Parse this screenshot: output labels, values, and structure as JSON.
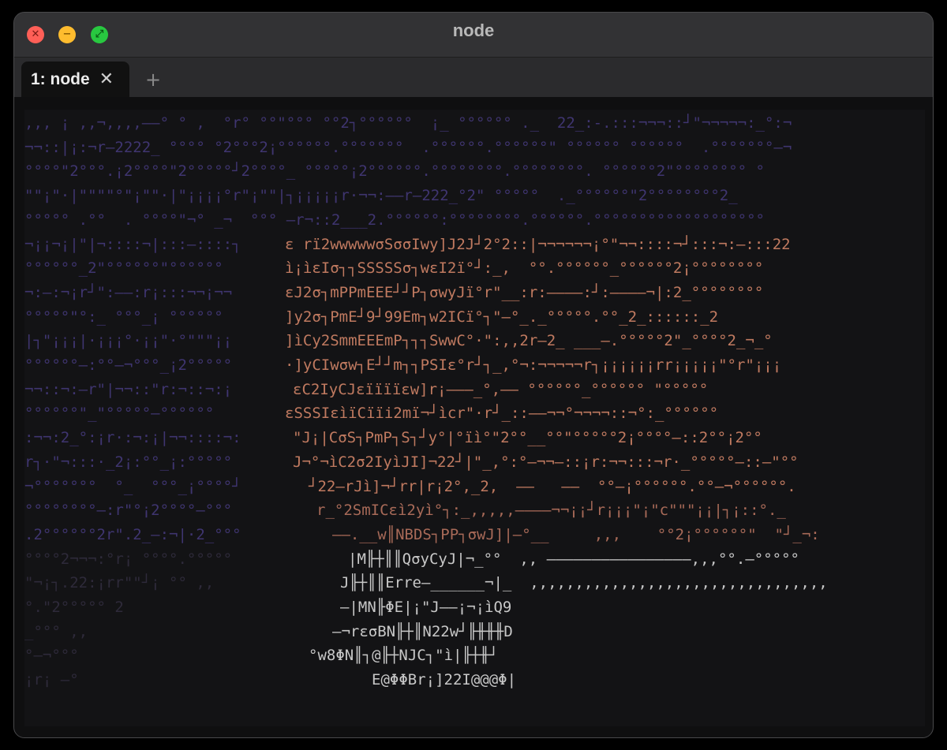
{
  "window": {
    "title": "node",
    "traffic": {
      "close": "✕",
      "minimize": "−",
      "maximize": "⤢"
    }
  },
  "tabs": [
    {
      "label": "1: node",
      "close_icon": "✕"
    }
  ],
  "add_tab_icon": "+",
  "terminal": {
    "background_lines": [
      ",,, ¡ ,,¬,,,,——° ° ,  °r° °°\"°°° °°2┐°°°°°°  ¡_ °°°°°° ._  22_:-.:::¬¬¬::┘\"¬¬¬¬¬:_°:¬",
      "¬¬::|¡:¬r—2222_ °°°° °2°°°2¡°°°°°°.°°°°°°°  .°°°°°°.°°°°°°\" °°°°°° °°°°°°  .°°°°°°°—¬",
      "°°°°\"2°°°.¡2°°°°\"2°°°°°┘2°°°°_ °°°°°¡2°°°°°°.°°°°°°°°.°°°°°°°°. °°°°°°2\"°°°°°°°° °",
      "\"\"¡\"·|\"\"\"\"°\"¡\"\"·|\"¡¡¡¡°r\"¡\"\"|┐¡¡¡¡¡r·¬¬:——r—222_°2\" °°°°°  ._°°°°°°\"2°°°°°°°°2_",
      "°°°°° .°°  . °°°°\"¬° _¬  °°° —r¬::2___2.°°°°°°:°°°°°°°°.°°°°°°.°°°°°°°°°°°°°°°°°°°",
      "¬¡¡¬¡|\"|¬::::¬|:::—::::┐",
      "°°°°°°_2\"°°°°°°\"°°°°°°",
      "¬:—:¬¡r┘\":——:r¡:::¬¬¡¬¬",
      "°°°°°\"°:_ °°°_¡ °°°°°°",
      "|┐\"¡¡¡|·¡¡¡°·¡¡\"·°\"\"\"¡¡",
      "°°°°°°—:°°—¬°°°_¡2°°°°°",
      "¬¬::¬:—r\"|¬¬::\"r:¬::¬:¡",
      "°°°°°°\"_\"°°°°°—°°°°°°",
      ":¬¬:2_°:¡r·:¬:¡|¬¬::::¬:",
      "r┐·\"¬:::·_2¡:°°_¡:°°°°°",
      "¬°°°°°°°  °_  °°°_¡°°°°┘",
      "°°°°°°°°—:r\"°¡2°°°°—°°°",
      ".2°°°°°°2r\".2_—:¬|·2_°°°",
      "°°°°2¬¬¬:°r¡ °°°°.°°°°°",
      "\"¬¡┐.22:¡rr\"\"┘¡ °° ,,",
      "°.\"2°°°°° 2 ",
      "_°°° ,,",
      "°—¬°°°",
      "¡r¡ —°"
    ],
    "figure_lines": [
      "ε rï2wwwwwσSσσIwy]J2J┘2°2::|¬¬¬¬¬¬¡°\"¬¬::::¬┘:::¬:—:::22",
      "ì¡ìεIσ┐┐SSSSSσ┐wεI2ï°┘:_,  °°.°°°°°°_°°°°°°2¡°°°°°°°°",
      "εJ2σ┐mPPmEEE┘┘P┐σwyJï°r\"__:r:————:┘:————¬|:2_°°°°°°°°",
      "]y2σ┐PmE┘9┘99Em┐w2ICï°┐\"—°_._°°°°°.°°_2_::::::_2",
      "]ìCy2SmmEEEmP┐┐┐SwwC°·\":,,2r—2_ ___—.°°°°°2\"_°°°°2_¬_°",
      "·]yCIwσw┐E┘┘m┐┐PSIε°r┘┐_,°¬:¬¬¬¬¬r┐¡¡¡¡¡¡rr¡¡¡¡¡\"°r\"¡¡¡",
      "εC2IyCJεïïïïεw]r¡———_°,—— °°°°°°_°°°°°° \"°°°°°",
      "εSSSIεìïCïïi2mï¬┘ìcr\"·r┘_::——¬¬°¬¬¬¬::¬°:_°°°°°°",
      "\"J¡|CσS┐PmP┐S┐┘y°|°ïì°\"2°°__°°\"°°°°°2¡°°°°—::2°°¡2°°",
      "J¬°¬ìC2σ2IyìJI]¬22┘|\"_,°:°—¬¬—::¡r:¬¬:::¬r·_°°°°°—::—\"°°",
      "┘22—rJì]¬┘rr|r¡2°,_2,  ——   ——  °°—¡°°°°°°.°°—¬°°°°°°.",
      "r_°2SmICεì2yì°┐:_,,,,,————¬¬¡¡┘r¡¡¡\"¡\"c\"\"\"¡¡|┐¡::°._",
      "——.__w║NBDS┐PP┐σwJ]|—°__     ,,,    °°2¡°°°°°°\"  \"┘_¬:",
      "|M╟┼║║QσyCyJ|¬_°°  ,, ————————————————,,,°°.—°°°°°",
      "J╟┼║║Erre—______¬|_  ,,,,,,,,,,,,,,,,,,,,,,,,,,,,,,,,,",
      "—|MN╟ΦE|¡\"J——¡¬¡ìQ9",
      "—¬rεσBN╟┼║N22w┘╟╫╫╫D",
      "°w8ΦN║┐@╟┼NJC┐\"ì|╟┼╫┘",
      "E@ΦΦBr¡]22I@@@Φ|"
    ]
  }
}
